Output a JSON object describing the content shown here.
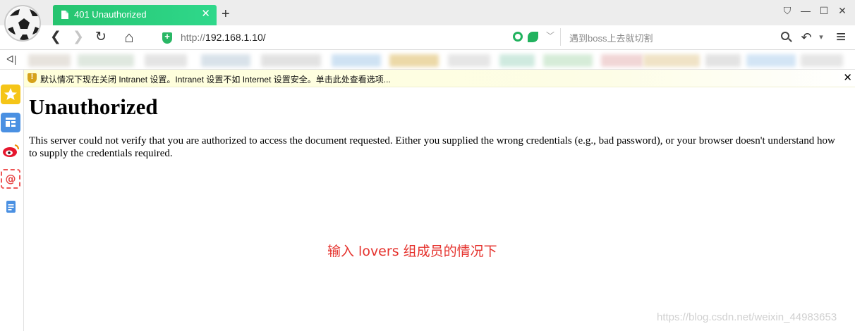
{
  "tab": {
    "title": "401 Unauthorized",
    "close": "✕",
    "new_tab": "+"
  },
  "window_controls": {
    "skin": "⛉",
    "minimize": "—",
    "maximize": "☐",
    "close": "✕"
  },
  "nav": {
    "back": "❮",
    "forward": "❯",
    "reload": "↻",
    "home": "⌂",
    "url_prefix": "http://",
    "url_host": "192.168.1.10/",
    "search_placeholder": "遇到boss上去就切割",
    "undo": "↶",
    "undo_dropdown": "▾",
    "url_dropdown": "﹀",
    "menu": "≡"
  },
  "bookmarks_toggle": "ᐊ|",
  "infobar": {
    "text": "默认情况下现在关闭 Intranet 设置。Intranet 设置不如 Internet 设置安全。单击此处查看选项...",
    "close": "✕"
  },
  "page": {
    "heading": "Unauthorized",
    "paragraph": "This server could not verify that you are authorized to access the document requested. Either you supplied the wrong credentials (e.g., bad password), or your browser doesn't understand how to supply the credentials required.",
    "caption": "输入 lovers 组成员的情况下",
    "watermark": "https://blog.csdn.net/weixin_44983653"
  },
  "colors": {
    "tab_accent": "#2fd88b",
    "caption": "#e5322d",
    "infobar": "#ffffd9"
  },
  "sidebar_icons": [
    "star-icon",
    "news-icon",
    "weibo-icon",
    "mail-icon",
    "note-icon"
  ]
}
